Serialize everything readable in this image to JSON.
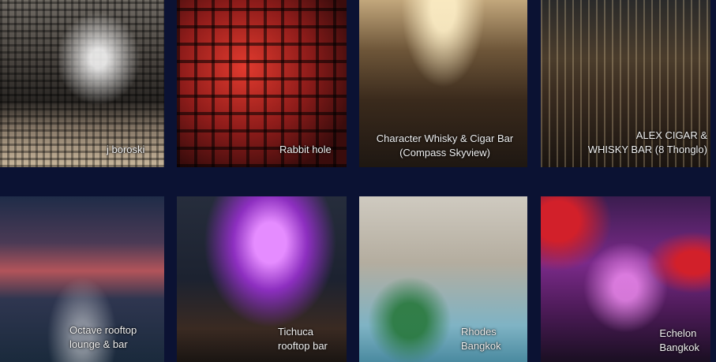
{
  "tiles": [
    {
      "caption": "j boroski"
    },
    {
      "caption": "Rabbit hole"
    },
    {
      "caption": "Character Whisky & Cigar Bar\n(Compass Skyview)"
    },
    {
      "caption": "ALEX CIGAR &\nWHISKY BAR (8 Thonglo)"
    },
    {
      "caption": "Octave rooftop\nlounge & bar"
    },
    {
      "caption": "Tichuca\nrooftop bar"
    },
    {
      "caption": "Rhodes\nBangkok"
    },
    {
      "caption": "Echelon\nBangkok"
    }
  ]
}
